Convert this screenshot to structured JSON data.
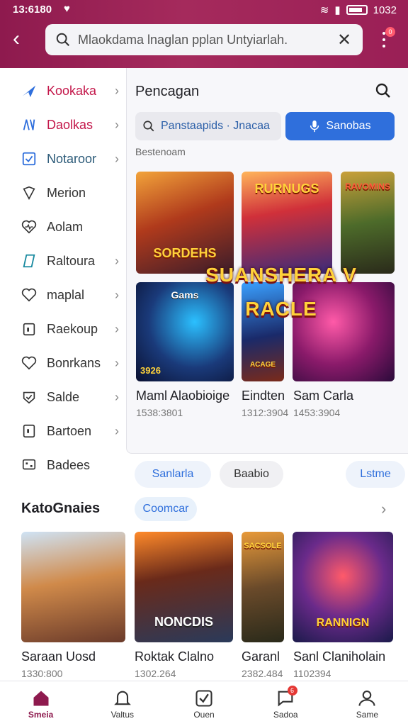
{
  "status": {
    "time": "13:6180",
    "battery": "1032"
  },
  "search": {
    "value": "Mlaokdama lnaglan pplan Untyiarlah."
  },
  "menu": {
    "badge": "0"
  },
  "sidebar": {
    "items": [
      {
        "label": "Kookaka"
      },
      {
        "label": "Daolkas"
      },
      {
        "label": "Notaroor"
      },
      {
        "label": "Merion"
      },
      {
        "label": "Aolam"
      },
      {
        "label": "Raltoura"
      },
      {
        "label": "maplal"
      },
      {
        "label": "Raekoup"
      },
      {
        "label": "Bonrkans"
      },
      {
        "label": "Salde"
      },
      {
        "label": "Bartoen"
      },
      {
        "label": "Badees"
      }
    ]
  },
  "panel": {
    "title": "Pencagan",
    "field_value": "Panstaapids · Jnacaa",
    "button_label": "Sanobas",
    "subtitle": "Bestenoam",
    "banner": "SUANSHERA V RACLE",
    "cards": [
      {
        "art_text": "SORDEHS"
      },
      {
        "art_text": "RURNUGS"
      },
      {
        "art_text": "RAVOMINS"
      },
      {
        "art_text": "Gams",
        "badge": "3926",
        "title": "Maml Alaobioige",
        "meta": "1538:3801"
      },
      {
        "art_text": "ACAGE",
        "title": "Eindten",
        "meta": "1312:3904"
      },
      {
        "art_text": "",
        "title": "Sam Carla",
        "meta": "1453:3904"
      }
    ]
  },
  "chips": [
    {
      "label": "Sanlarla"
    },
    {
      "label": "Baabio"
    },
    {
      "label": "Lstme"
    }
  ],
  "section": {
    "title": "KatoGnaies",
    "chip": "Coomcar",
    "cards": [
      {
        "art_text": "",
        "title": "Saraan Uosd",
        "meta": "1330:800"
      },
      {
        "art_text": "NONCDIS",
        "title": "Roktak Clalno",
        "meta": "1302.264"
      },
      {
        "art_text": "SACSOLE",
        "title": "Garanl",
        "meta": "2382.484"
      },
      {
        "art_text": "RANNIGN",
        "title": "Sanl Claniholain",
        "meta": "1102394"
      }
    ]
  },
  "bottom_nav": [
    {
      "label": "Smeia",
      "icon": "home-icon"
    },
    {
      "label": "Valtus",
      "icon": "bell-icon"
    },
    {
      "label": "Ouen",
      "icon": "check-square-icon"
    },
    {
      "label": "Sadoa",
      "icon": "chat-icon",
      "badge": "6"
    },
    {
      "label": "Same",
      "icon": "person-icon"
    }
  ],
  "colors": {
    "brand": "#8e1a4e",
    "accent": "#2f6fdc",
    "active_sidebar": "#c3174a"
  }
}
